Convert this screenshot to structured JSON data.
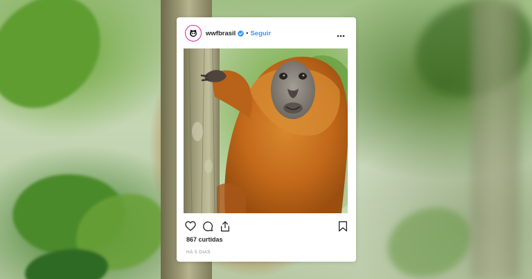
{
  "post": {
    "username": "wwfbrasil",
    "separator": "•",
    "follow_label": "Seguir",
    "likes": "867 curtidas",
    "time": "HÁ 5 DIAS"
  },
  "icons": {
    "avatar": "wwf-panda-logo",
    "verified": "verified-badge-icon",
    "more": "more-options-icon",
    "like": "heart-icon",
    "comment": "comment-icon",
    "share": "share-icon",
    "save": "bookmark-icon"
  },
  "colors": {
    "link": "#3897f0",
    "text": "#262626",
    "muted": "#8e8e8e",
    "monkey": "#c96e1c"
  }
}
